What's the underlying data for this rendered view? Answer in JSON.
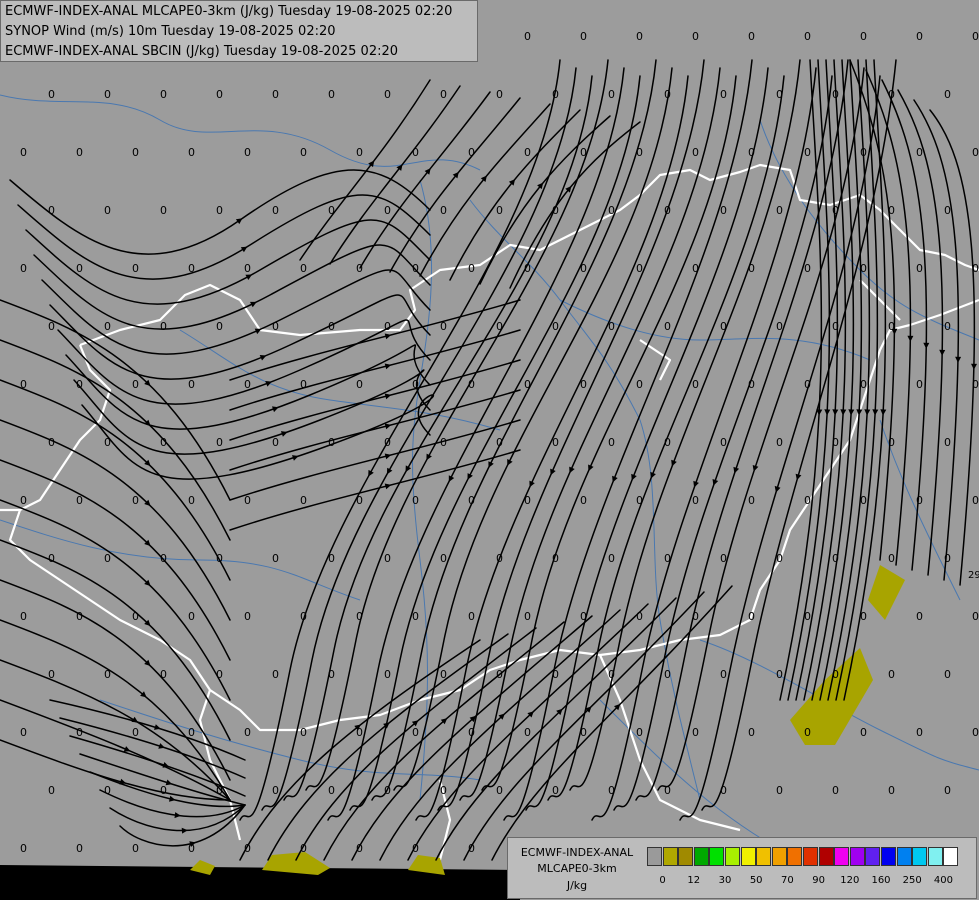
{
  "titles": [
    "ECMWF-INDEX-ANAL MLCAPE0-3km (J/kg) Tuesday 19-08-2025 02:20",
    "SYNOP Wind (m/s) 10m Tuesday 19-08-2025 02:20",
    "ECMWF-INDEX-ANAL SBCIN (J/kg) Tuesday 19-08-2025 02:20"
  ],
  "legend": {
    "name_lines": [
      "ECMWF-INDEX-ANAL",
      "MLCAPE0-3km",
      "J/kg"
    ],
    "colors": [
      "#9a9a9a",
      "#b0a800",
      "#a08a00",
      "#00a800",
      "#00e000",
      "#a8f000",
      "#f0f000",
      "#f0c000",
      "#f0a000",
      "#f07000",
      "#e03000",
      "#b00000",
      "#f000f0",
      "#a000f0",
      "#6020f0",
      "#0000f0",
      "#0080f0",
      "#00c8f0",
      "#80f0f0",
      "#ffffff"
    ],
    "tick_labels": [
      "0",
      "12",
      "30",
      "50",
      "70",
      "90",
      "120",
      "160",
      "250",
      "400"
    ]
  },
  "map_labels": {
    "value": "0",
    "edge_value": "29"
  },
  "colors": {
    "background": "#9c9c9c",
    "border_country": "#ffffff",
    "river": "#4a78b0",
    "streamline": "#000000",
    "cape_fill": "#a8a400"
  }
}
